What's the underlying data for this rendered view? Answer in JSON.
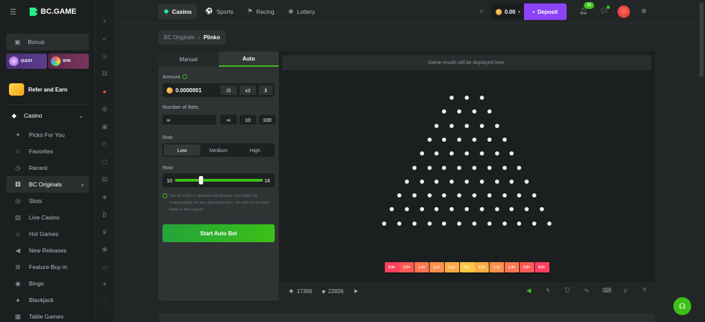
{
  "brand": {
    "name": "BC.GAME"
  },
  "sidebar": {
    "bonus_label": "Bonus",
    "quest_label": "QUEST",
    "spin_label": "SPIN",
    "refer_label": "Refer and Earn",
    "casino_label": "Casino",
    "items": [
      {
        "label": "Picks For You",
        "icon": "sparkle-icon"
      },
      {
        "label": "Favorites",
        "icon": "star-icon"
      },
      {
        "label": "Recent",
        "icon": "clock-icon"
      },
      {
        "label": "BC Originals",
        "icon": "dice-icon",
        "active": true
      },
      {
        "label": "Slots",
        "icon": "slot-icon"
      },
      {
        "label": "Live Casino",
        "icon": "live-icon"
      },
      {
        "label": "Hot Games",
        "icon": "flame-icon"
      },
      {
        "label": "New Releases",
        "icon": "megaphone-icon"
      },
      {
        "label": "Feature Buy-in",
        "icon": "cart-icon"
      },
      {
        "label": "Bingo",
        "icon": "bingo-icon"
      },
      {
        "label": "Blackjack",
        "icon": "cards-icon"
      },
      {
        "label": "Table Games",
        "icon": "table-icon"
      }
    ]
  },
  "topbar": {
    "tabs": [
      {
        "label": "Casino",
        "active": true
      },
      {
        "label": "Sports"
      },
      {
        "label": "Racing"
      },
      {
        "label": "Lottery"
      }
    ],
    "balance": "0.00",
    "deposit_label": "Deposit",
    "notification_count": "11"
  },
  "breadcrumb": {
    "parent": "BC Originals",
    "separator": "›",
    "current": "Plinko"
  },
  "panel": {
    "tabs": [
      {
        "label": "Manual"
      },
      {
        "label": "Auto",
        "active": true
      }
    ],
    "amount_label": "Amount",
    "amount_value": "0.0000001",
    "half_label": "/2",
    "double_label": "x2",
    "bets_label": "Number of Bets",
    "bets_value": "∞",
    "bets_options": [
      "∞",
      "10",
      "100"
    ],
    "risk_label": "Risk",
    "risk_options": [
      "Low",
      "Medium",
      "High"
    ],
    "risk_selected": "Low",
    "row_label": "Row",
    "row_min": "10",
    "row_max": "16",
    "row_value": 10,
    "disclaimer": "Use of script is optional and players must take full responsibility for any attendant risks. We will not be held liable in this regard.",
    "start_label": "Start Auto Bet"
  },
  "game": {
    "results_placeholder": "Game results will be displayed here.",
    "rows": 10,
    "multipliers": [
      "8.9×",
      "3.0×",
      "1.4×",
      "1.1×",
      "1.0×",
      "0.5×",
      "1.0×",
      "1.1×",
      "1.4×",
      "3.0×",
      "8.9×"
    ],
    "slot_colors": [
      "#ff3f5f",
      "#ff5a56",
      "#ff7650",
      "#ff914b",
      "#ffac46",
      "#ffc741",
      "#ffac46",
      "#ff914b",
      "#ff7650",
      "#ff5a56",
      "#ff3f5f"
    ],
    "favorites_count": "17366",
    "likes_count": "22826"
  },
  "colors": {
    "accent": "#3bc117",
    "deposit": "#8b44f7",
    "brand": "#24ee89"
  }
}
